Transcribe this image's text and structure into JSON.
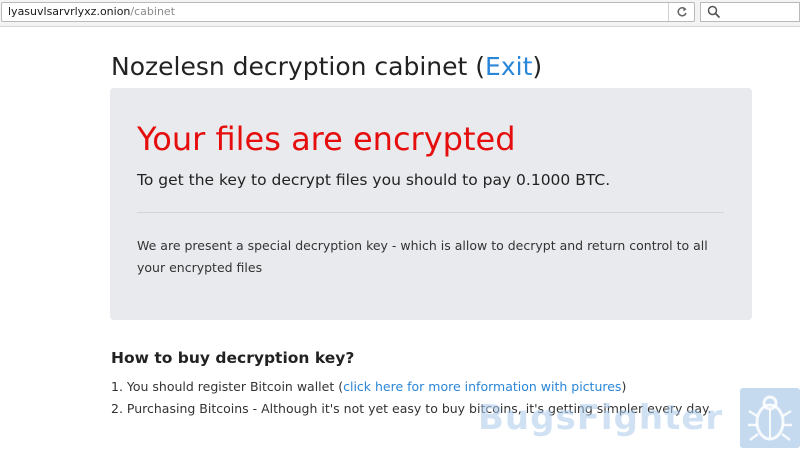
{
  "browser": {
    "url_host": "lyasuvlsarvrlyxz.onion",
    "url_path": "/cabinet"
  },
  "header": {
    "title_prefix": "Nozelesn decryption cabinet (",
    "exit_label": "Exit",
    "title_suffix": ")"
  },
  "notice": {
    "headline": "Your files are encrypted",
    "lead": "To get the key to decrypt files you should to pay 0.1000 BTC.",
    "description": "We are present a special decryption key - which is allow to decrypt and return control to all your encrypted files"
  },
  "instructions": {
    "title": "How to buy decryption key?",
    "step1_prefix": "1. You should register Bitcoin wallet (",
    "step1_link": "click here for more information with pictures",
    "step1_suffix": ")",
    "step2": "2. Purchasing Bitcoins - Although it's not yet easy to buy bitcoins, it's getting simpler every day."
  },
  "watermark": {
    "text": "BugsFighter"
  },
  "colors": {
    "headline": "#e60d0d",
    "link": "#2a86d8",
    "panel": "#e8eaed"
  },
  "icons": {
    "reload": "reload-icon",
    "search": "search-icon",
    "watermark": "bug-icon"
  }
}
